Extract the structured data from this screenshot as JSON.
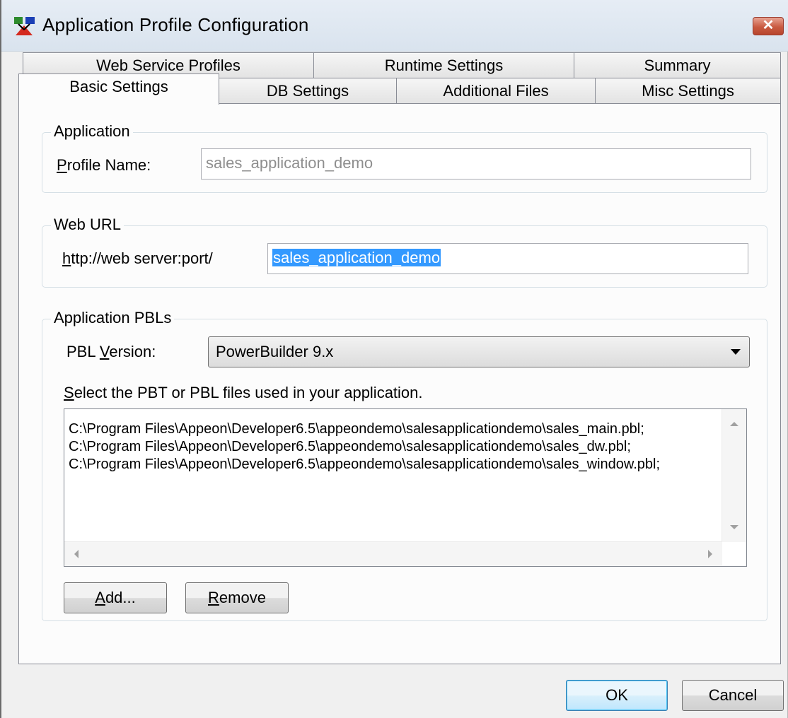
{
  "window": {
    "title": "Application Profile Configuration",
    "close_glyph": "✕"
  },
  "tabs": {
    "row_back": [
      {
        "label": "Web Service Profiles"
      },
      {
        "label": "Runtime Settings"
      },
      {
        "label": "Summary"
      }
    ],
    "row_front": [
      {
        "label": "Basic Settings",
        "active": true
      },
      {
        "label": "DB Settings"
      },
      {
        "label": "Additional Files"
      },
      {
        "label": "Misc Settings"
      }
    ]
  },
  "application": {
    "group_title": "Application",
    "profile_label_mnemonic": "P",
    "profile_label_rest": "rofile Name:",
    "profile_value": "sales_application_demo"
  },
  "web_url": {
    "group_title": "Web URL",
    "prefix_mnemonic": "h",
    "prefix_rest": "ttp://web server:port/",
    "value": "sales_application_demo"
  },
  "pbls": {
    "group_title": "Application PBLs",
    "version_label_pre": "PBL ",
    "version_label_mnemonic": "V",
    "version_label_post": "ersion:",
    "version_value": "PowerBuilder 9.x",
    "instruction_mnemonic": "S",
    "instruction_rest": "elect the PBT or PBL files used in your application.",
    "files": [
      "C:\\Program Files\\Appeon\\Developer6.5\\appeondemo\\salesapplicationdemo\\sales_main.pbl;",
      "C:\\Program Files\\Appeon\\Developer6.5\\appeondemo\\salesapplicationdemo\\sales_dw.pbl;",
      "C:\\Program Files\\Appeon\\Developer6.5\\appeondemo\\salesapplicationdemo\\sales_window.pbl;"
    ],
    "add_mnemonic": "A",
    "add_rest": "dd...",
    "remove_mnemonic": "R",
    "remove_rest": "emove"
  },
  "footer": {
    "ok_label": "OK",
    "cancel_label": "Cancel"
  },
  "colors": {
    "selection": "#3399ff",
    "close_button": "#c95a41",
    "disabled_text": "#8e8e8e"
  }
}
